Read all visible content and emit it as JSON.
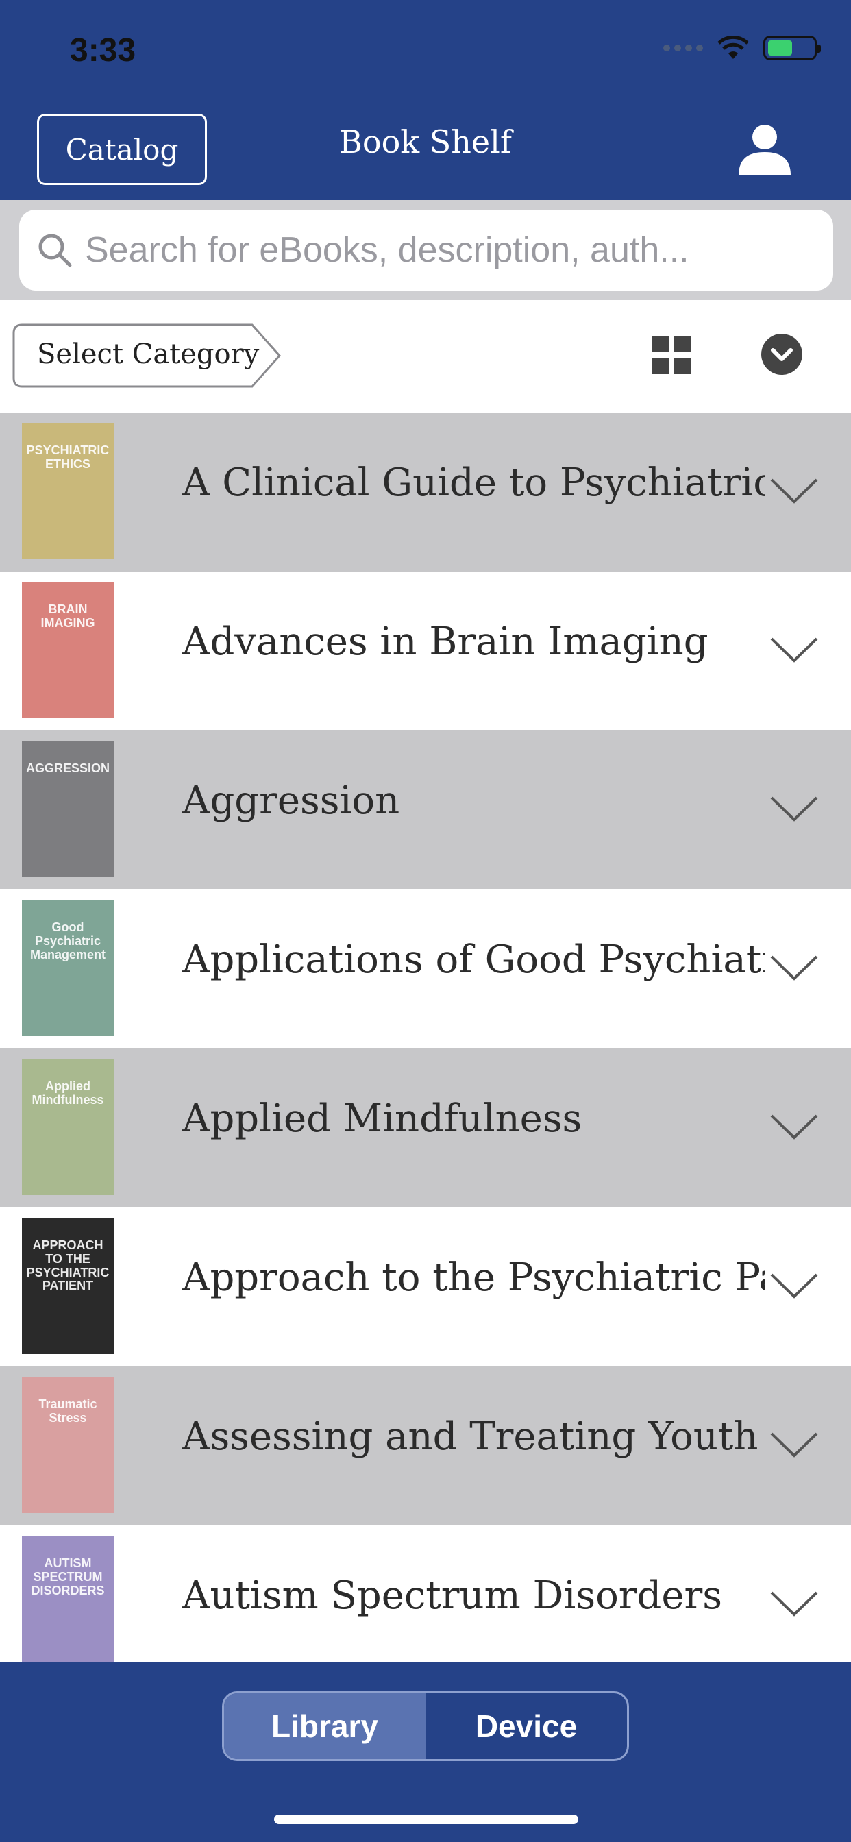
{
  "status_bar": {
    "time": "3:33"
  },
  "header": {
    "catalog_label": "Catalog",
    "title": "Book Shelf"
  },
  "search": {
    "placeholder": "Search for eBooks, description, auth..."
  },
  "filter": {
    "category_label": "Select Category"
  },
  "books": [
    {
      "title": "A Clinical Guide to Psychiatric...",
      "cover_text": "PSYCHIATRIC ETHICS",
      "cover_color": "#c9b87a"
    },
    {
      "title": "Advances in Brain Imaging",
      "cover_text": "BRAIN IMAGING",
      "cover_color": "#d9827c"
    },
    {
      "title": "Aggression",
      "cover_text": "AGGRESSION",
      "cover_color": "#7d7d80"
    },
    {
      "title": "Applications of Good Psychiatri...",
      "cover_text": "Good Psychiatric Management",
      "cover_color": "#7fa596"
    },
    {
      "title": "Applied Mindfulness",
      "cover_text": "Applied Mindfulness",
      "cover_color": "#a9b98f"
    },
    {
      "title": "Approach to the Psychiatric Pat...",
      "cover_text": "APPROACH TO THE PSYCHIATRIC PATIENT",
      "cover_color": "#2a2a2a"
    },
    {
      "title": "Assessing and Treating Youth E...",
      "cover_text": "Traumatic Stress",
      "cover_color": "#d9a0a0"
    },
    {
      "title": "Autism Spectrum Disorders",
      "cover_text": "AUTISM SPECTRUM DISORDERS",
      "cover_color": "#9b8fc4"
    }
  ],
  "tabs": {
    "library": "Library",
    "device": "Device",
    "active": "Library"
  },
  "colors": {
    "brand": "#254288",
    "row_alt": "#c7c7c9",
    "segment_active": "#5a73b1"
  }
}
